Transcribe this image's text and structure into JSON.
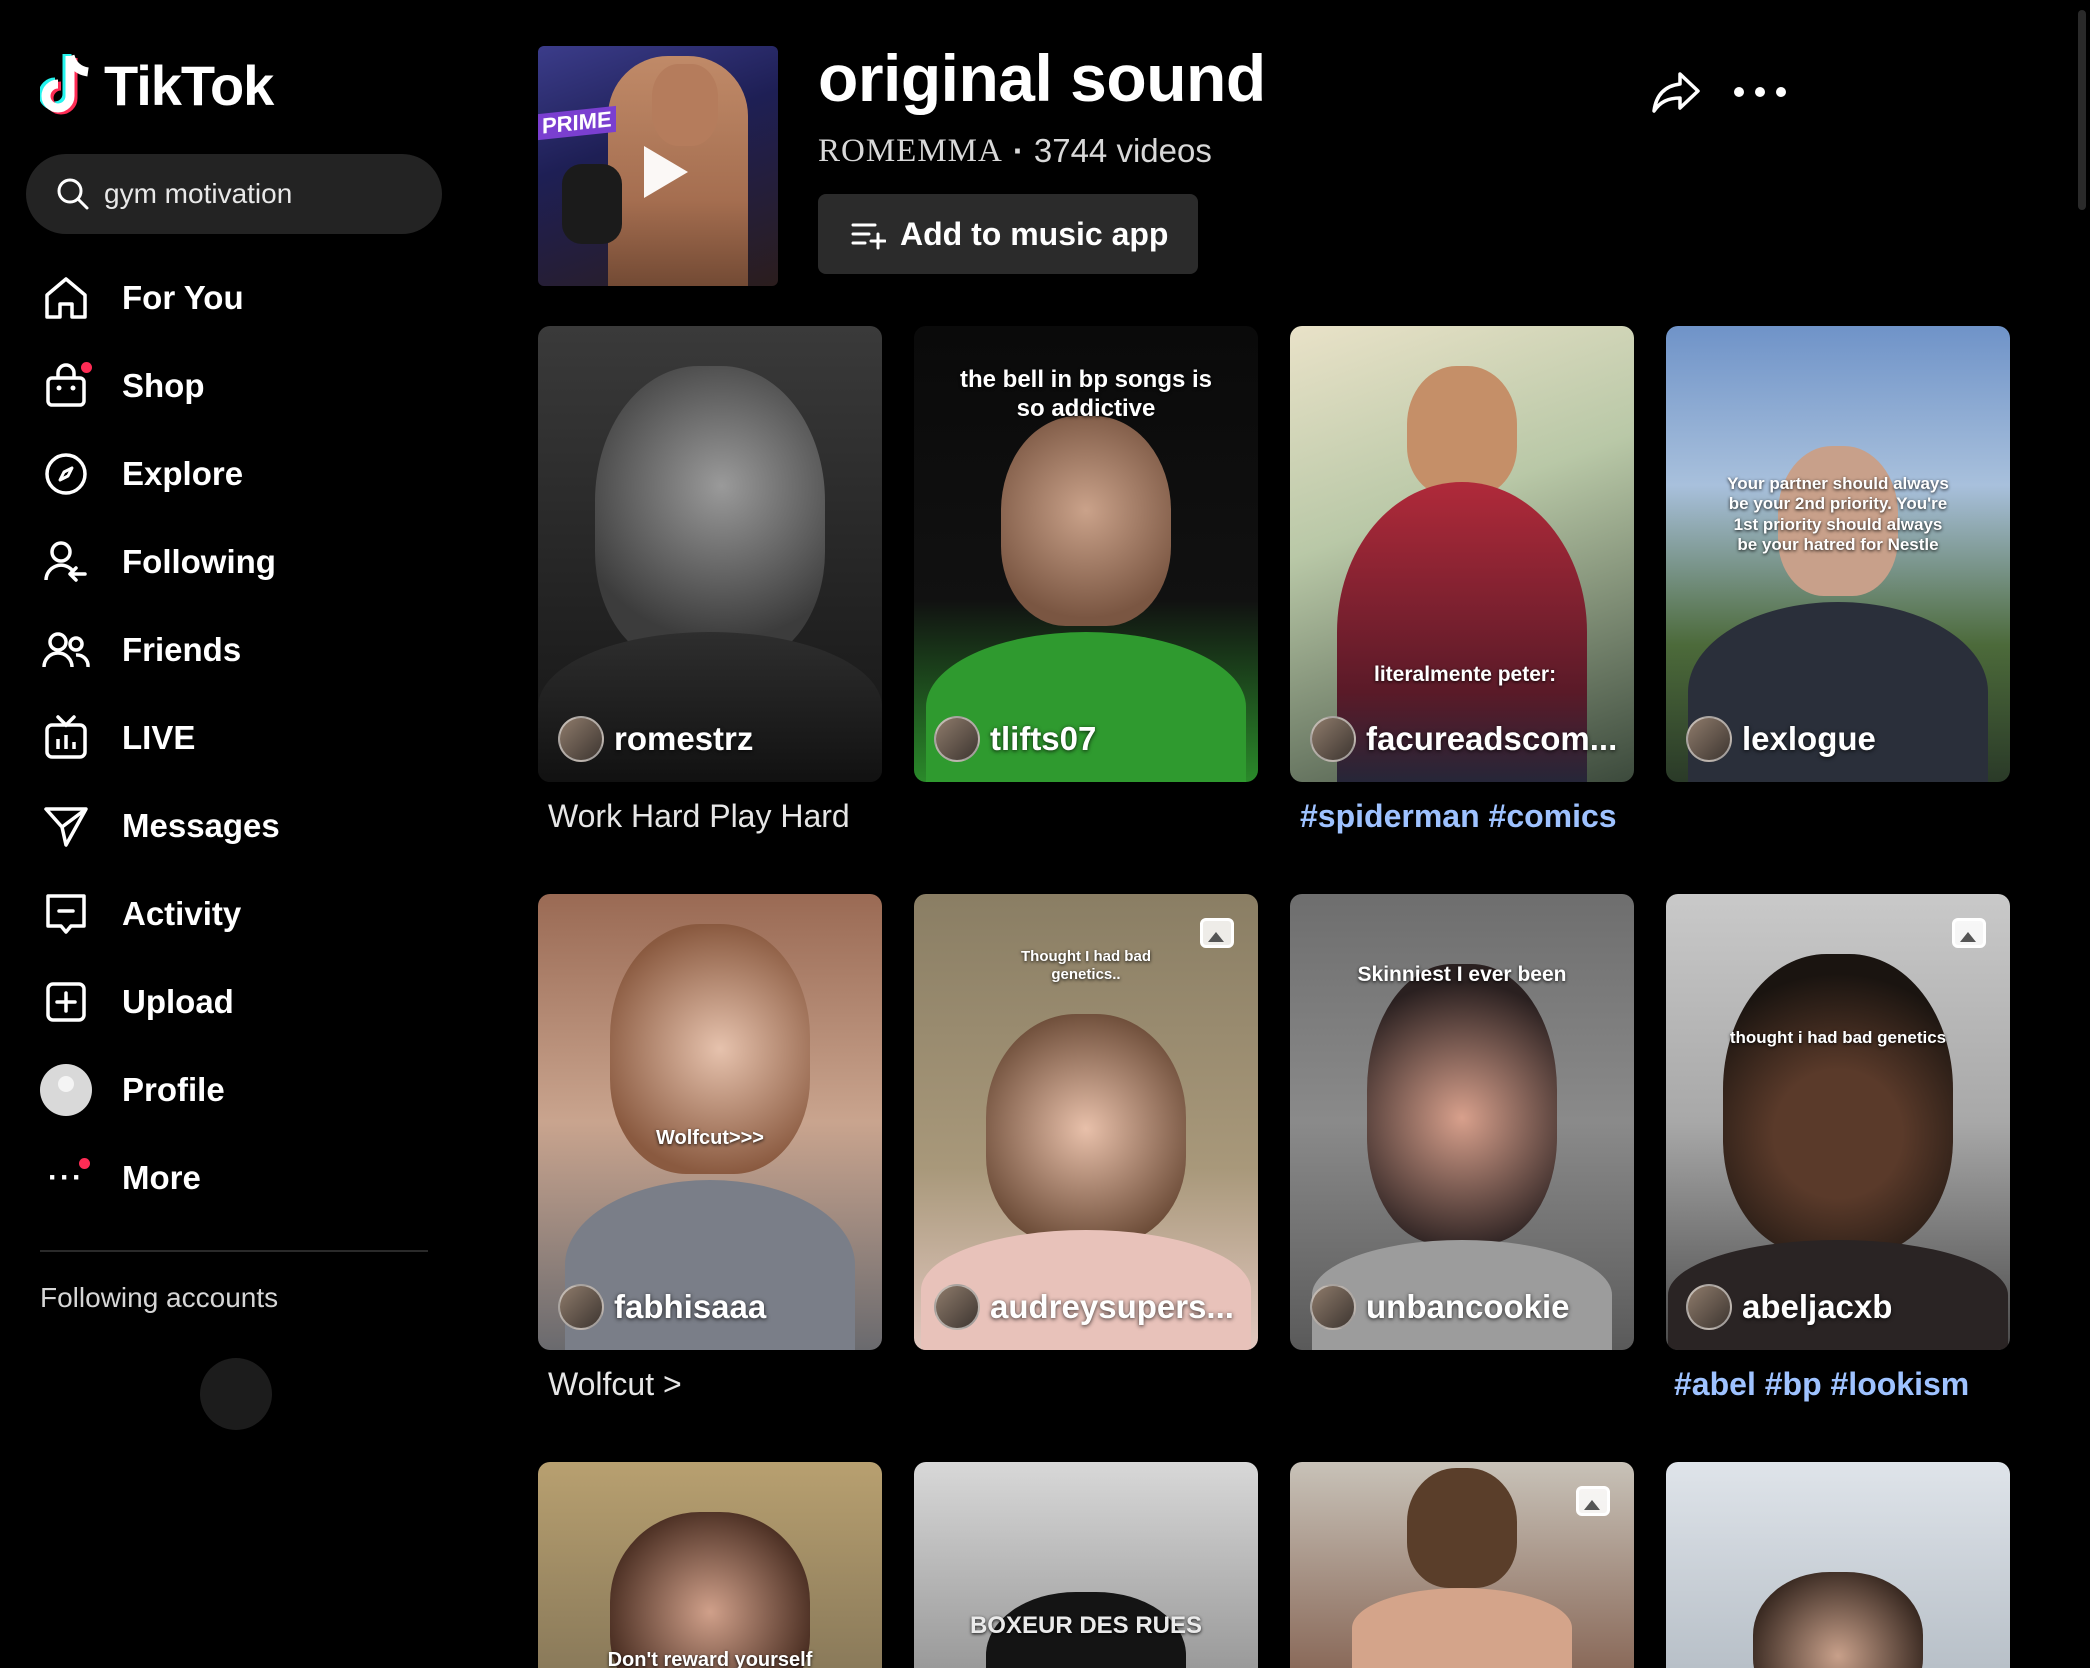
{
  "app": {
    "name": "TikTok"
  },
  "search": {
    "value": "gym motivation"
  },
  "nav": [
    {
      "label": "For You",
      "icon": "home-icon"
    },
    {
      "label": "Shop",
      "icon": "shop-bag-icon"
    },
    {
      "label": "Explore",
      "icon": "compass-icon"
    },
    {
      "label": "Following",
      "icon": "following-icon"
    },
    {
      "label": "Friends",
      "icon": "friends-icon"
    },
    {
      "label": "LIVE",
      "icon": "live-tv-icon"
    },
    {
      "label": "Messages",
      "icon": "send-icon"
    },
    {
      "label": "Activity",
      "icon": "activity-icon"
    },
    {
      "label": "Upload",
      "icon": "plus-square-icon"
    },
    {
      "label": "Profile",
      "icon": "profile-avatar"
    },
    {
      "label": "More",
      "icon": "more-dots-icon"
    }
  ],
  "sidebar_section": {
    "following_accounts": "Following accounts"
  },
  "sound": {
    "title": "original sound",
    "author": "ROMEMMA",
    "separator": "·",
    "video_count": "3744 videos",
    "add_button": "Add to music app",
    "cover_text": "PRIME"
  },
  "videos": [
    {
      "user": "romestrz",
      "overlay": "",
      "caption": "Work Hard Play Hard",
      "photo": false
    },
    {
      "user": "tlifts07",
      "overlay": "the bell in bp songs is so addictive",
      "caption": "",
      "photo": false
    },
    {
      "user": "facureadscom...",
      "overlay": "literalmente peter:",
      "caption": "#spiderman #comics",
      "photo": false
    },
    {
      "user": "lexlogue",
      "overlay": "Your partner should always be your 2nd priority. You're 1st priority should always be your hatred for Nestle",
      "caption": "",
      "photo": false
    },
    {
      "user": "fabhisaaa",
      "overlay": "Wolfcut>>>",
      "caption": "Wolfcut >",
      "photo": false
    },
    {
      "user": "audreysupers...",
      "overlay": "Thought I had bad genetics..",
      "caption": "",
      "photo": true
    },
    {
      "user": "unbancookie",
      "overlay": "Skinniest I ever been",
      "caption": "",
      "photo": false
    },
    {
      "user": "abeljacxb",
      "overlay": "thought i had bad genetics",
      "caption": "#abel #bp #lookism",
      "photo": true
    },
    {
      "user": "",
      "overlay": "Don't reward yourself",
      "caption": "",
      "photo": false
    },
    {
      "user": "",
      "overlay": "BOXEUR DES RUES",
      "caption": "",
      "photo": false
    },
    {
      "user": "",
      "overlay": "",
      "caption": "",
      "photo": true
    },
    {
      "user": "",
      "overlay": "",
      "caption": "",
      "photo": false
    }
  ],
  "colors": {
    "background": "#000000",
    "accent": "#fe2c55",
    "hashtag": "#9ec2ff",
    "button": "#2b2b2b"
  }
}
